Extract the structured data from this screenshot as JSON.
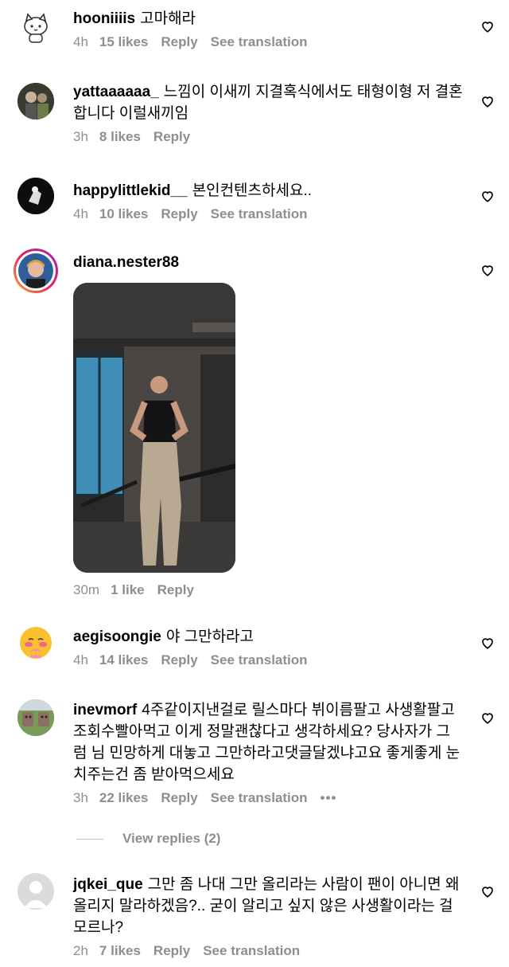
{
  "comments": [
    {
      "user": "hooniiiis",
      "text": "고마해라",
      "time": "4h",
      "likes": "15 likes",
      "reply": "Reply",
      "translate": "See translation"
    },
    {
      "user": "yattaaaaaa_",
      "text": "느낌이 이새끼 지결혹식에서도 태형이형 저 결혼합니다 이럴새끼임",
      "time": "3h",
      "likes": "8 likes",
      "reply": "Reply"
    },
    {
      "user": "happylittlekid__",
      "text": "본인컨텐츠하세요..",
      "time": "4h",
      "likes": "10 likes",
      "reply": "Reply",
      "translate": "See translation"
    },
    {
      "user": "diana.nester88",
      "time": "30m",
      "likes": "1 like",
      "reply": "Reply"
    },
    {
      "user": "aegisoongie",
      "text": "야 그만하라고",
      "time": "4h",
      "likes": "14 likes",
      "reply": "Reply",
      "translate": "See translation"
    },
    {
      "user": "inevmorf",
      "text": "4주같이지낸걸로 릴스마다 뷔이름팔고 사생활팔고 조회수빨아먹고 이게 정말괜찮다고 생각하세요? 당사자가 그럼 님 민망하게 대놓고 그만하라고댓글달겠냐고요 좋게좋게 눈치주는건 좀 받아먹으세요",
      "time": "3h",
      "likes": "22 likes",
      "reply": "Reply",
      "translate": "See translation",
      "more": "•••",
      "view_replies": "View replies (2)"
    },
    {
      "user": "jqkei_que",
      "text": "그만 좀 나대 그만 올리라는 사람이 팬이 아니면 왜 올리지 말라하겠음?.. 굳이 알리고 싶지 않은 사생활이라는 걸 모르나?",
      "time": "2h",
      "likes": "7 likes",
      "reply": "Reply",
      "translate": "See translation"
    }
  ],
  "icons": {
    "like": "heart-outline-icon",
    "default_avatar": "default-avatar-icon"
  }
}
